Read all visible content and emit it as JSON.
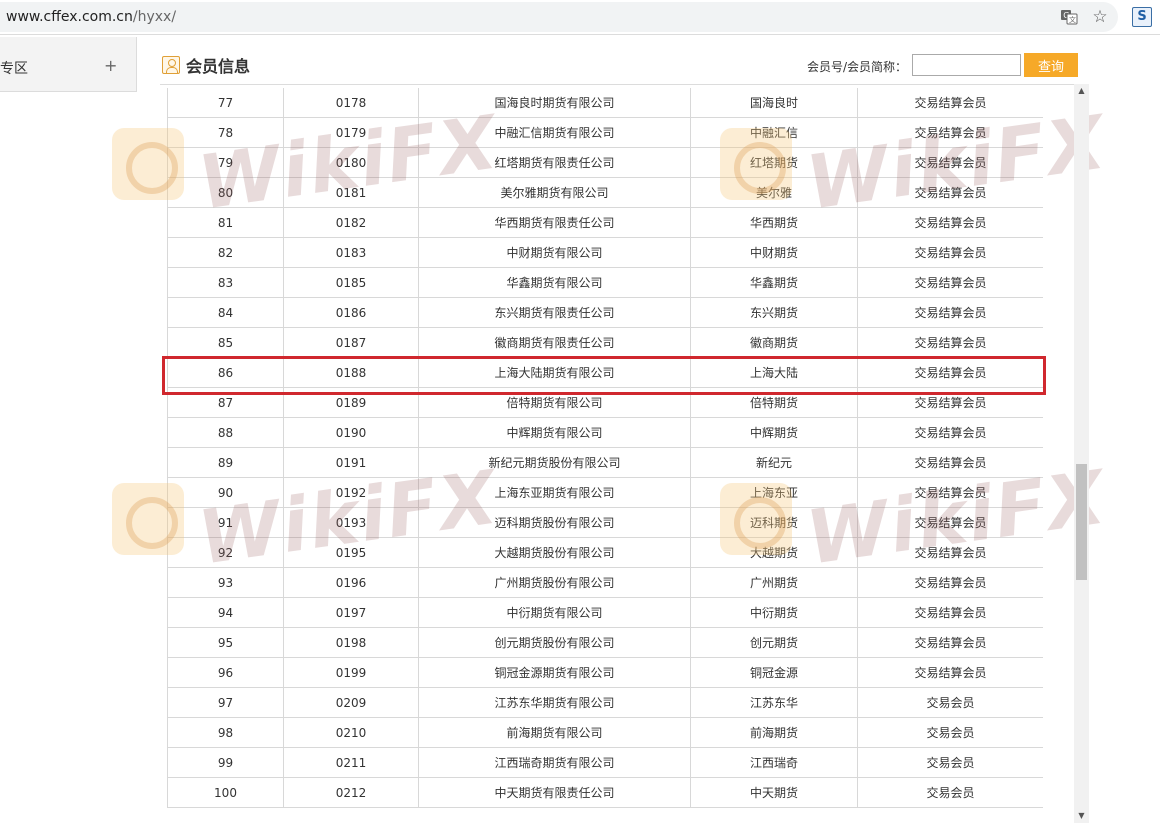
{
  "browser": {
    "url_host": "www.cffex.com.cn",
    "url_path": "/hyxx/"
  },
  "sidebar": {
    "label": "专区",
    "expand_symbol": "+"
  },
  "section": {
    "title": "会员信息",
    "search_label": "会员号/会员简称：",
    "search_value": "",
    "search_button": "查询"
  },
  "watermark_text": "WikiFX",
  "members": [
    {
      "no": "77",
      "code": "0178",
      "name": "国海良时期货有限公司",
      "short": "国海良时",
      "type": "交易结算会员"
    },
    {
      "no": "78",
      "code": "0179",
      "name": "中融汇信期货有限公司",
      "short": "中融汇信",
      "type": "交易结算会员"
    },
    {
      "no": "79",
      "code": "0180",
      "name": "红塔期货有限责任公司",
      "short": "红塔期货",
      "type": "交易结算会员"
    },
    {
      "no": "80",
      "code": "0181",
      "name": "美尔雅期货有限公司",
      "short": "美尔雅",
      "type": "交易结算会员"
    },
    {
      "no": "81",
      "code": "0182",
      "name": "华西期货有限责任公司",
      "short": "华西期货",
      "type": "交易结算会员"
    },
    {
      "no": "82",
      "code": "0183",
      "name": "中财期货有限公司",
      "short": "中财期货",
      "type": "交易结算会员"
    },
    {
      "no": "83",
      "code": "0185",
      "name": "华鑫期货有限公司",
      "short": "华鑫期货",
      "type": "交易结算会员"
    },
    {
      "no": "84",
      "code": "0186",
      "name": "东兴期货有限责任公司",
      "short": "东兴期货",
      "type": "交易结算会员"
    },
    {
      "no": "85",
      "code": "0187",
      "name": "徽商期货有限责任公司",
      "short": "徽商期货",
      "type": "交易结算会员"
    },
    {
      "no": "86",
      "code": "0188",
      "name": "上海大陆期货有限公司",
      "short": "上海大陆",
      "type": "交易结算会员"
    },
    {
      "no": "87",
      "code": "0189",
      "name": "倍特期货有限公司",
      "short": "倍特期货",
      "type": "交易结算会员"
    },
    {
      "no": "88",
      "code": "0190",
      "name": "中辉期货有限公司",
      "short": "中辉期货",
      "type": "交易结算会员"
    },
    {
      "no": "89",
      "code": "0191",
      "name": "新纪元期货股份有限公司",
      "short": "新纪元",
      "type": "交易结算会员"
    },
    {
      "no": "90",
      "code": "0192",
      "name": "上海东亚期货有限公司",
      "short": "上海东亚",
      "type": "交易结算会员"
    },
    {
      "no": "91",
      "code": "0193",
      "name": "迈科期货股份有限公司",
      "short": "迈科期货",
      "type": "交易结算会员"
    },
    {
      "no": "92",
      "code": "0195",
      "name": "大越期货股份有限公司",
      "short": "大越期货",
      "type": "交易结算会员"
    },
    {
      "no": "93",
      "code": "0196",
      "name": "广州期货股份有限公司",
      "short": "广州期货",
      "type": "交易结算会员"
    },
    {
      "no": "94",
      "code": "0197",
      "name": "中衍期货有限公司",
      "short": "中衍期货",
      "type": "交易结算会员"
    },
    {
      "no": "95",
      "code": "0198",
      "name": "创元期货股份有限公司",
      "short": "创元期货",
      "type": "交易结算会员"
    },
    {
      "no": "96",
      "code": "0199",
      "name": "铜冠金源期货有限公司",
      "short": "铜冠金源",
      "type": "交易结算会员"
    },
    {
      "no": "97",
      "code": "0209",
      "name": "江苏东华期货有限公司",
      "short": "江苏东华",
      "type": "交易会员"
    },
    {
      "no": "98",
      "code": "0210",
      "name": "前海期货有限公司",
      "short": "前海期货",
      "type": "交易会员"
    },
    {
      "no": "99",
      "code": "0211",
      "name": "江西瑞奇期货有限公司",
      "short": "江西瑞奇",
      "type": "交易会员"
    },
    {
      "no": "100",
      "code": "0212",
      "name": "中天期货有限责任公司",
      "short": "中天期货",
      "type": "交易会员"
    }
  ]
}
